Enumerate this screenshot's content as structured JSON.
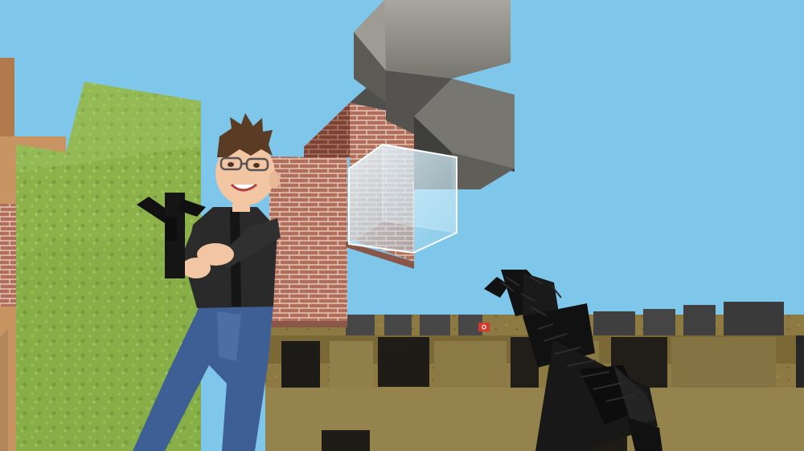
{
  "scene": {
    "type": "first-person voxel shooter",
    "sky_color": "#7ec7ea",
    "held_weapon": "blocky-assault-rifle",
    "hud_marker": "red-target-icon"
  },
  "materials": {
    "brick": "#b46d58",
    "grass": "#8db24a",
    "stone": "#9d9b94",
    "wood": "#c79462",
    "sand": "#8c7a42",
    "glass": "#d8eef7"
  },
  "avatar": {
    "hair": "#5a3b24",
    "skin": "#f2c5a3",
    "jacket": "#2a2a2a",
    "jeans": "#3e5f96",
    "glasses": "#555555"
  }
}
